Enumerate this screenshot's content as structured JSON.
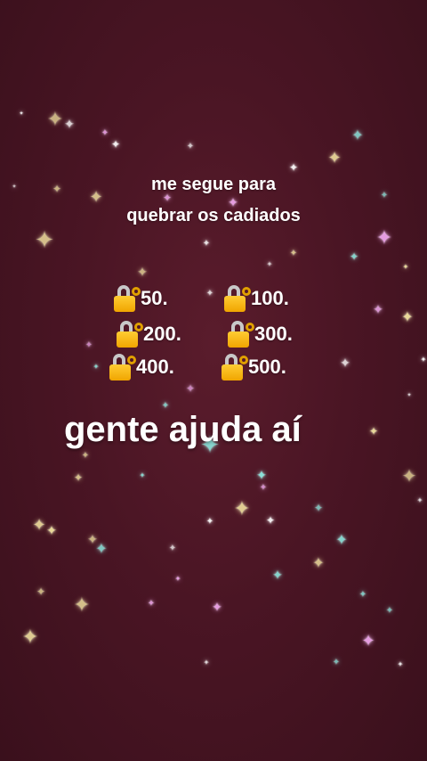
{
  "caption": {
    "line1": "me segue para",
    "line2": "quebrar os cadiados"
  },
  "locks": [
    {
      "label": "50.",
      "icon": "locked-with-key-icon"
    },
    {
      "label": "100.",
      "icon": "locked-with-key-icon"
    },
    {
      "label": "200.",
      "icon": "locked-with-key-icon"
    },
    {
      "label": "300.",
      "icon": "locked-with-key-icon"
    },
    {
      "label": "400.",
      "icon": "locked-with-key-icon"
    },
    {
      "label": "500.",
      "icon": "locked-with-key-icon"
    }
  ],
  "headline": "gente ajuda aí",
  "colors": {
    "background": "#4a1524",
    "text": "#ffffff",
    "sparkle_gold": "#f6e7a2",
    "sparkle_teal": "#8ff0e6",
    "sparkle_pink": "#f2a8ef"
  }
}
